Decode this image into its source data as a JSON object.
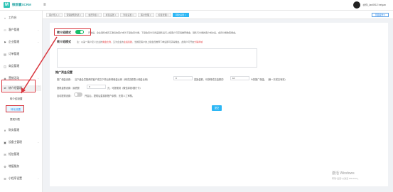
{
  "app": {
    "logo_text": "微群赢SCRM",
    "user_name": "@你_lanl0f12 heiyan"
  },
  "tabs": [
    {
      "label": "客户导入 ×"
    },
    {
      "label": "营销通知列表 ×"
    },
    {
      "label": "会员列表 ×"
    },
    {
      "label": "标签设置 ×"
    },
    {
      "label": "列表设置 ×"
    },
    {
      "label": "客户管理 ×"
    },
    {
      "label": "标签管理 ×"
    },
    {
      "label": "转化设置 ×"
    }
  ],
  "page_action": "页面操作 ▾",
  "sidebar": {
    "items": [
      {
        "label": "工作台",
        "icon": "⌂"
      },
      {
        "label": "客户管理",
        "icon": "⚇"
      },
      {
        "label": "企业管理",
        "icon": "⚑"
      },
      {
        "label": "订单管理",
        "icon": "▤"
      },
      {
        "label": "商品管理",
        "icon": "◫"
      },
      {
        "label": "营销活动",
        "icon": "◈"
      },
      {
        "label": "转介绍管理",
        "icon": "⇄"
      },
      {
        "label": "财务管理",
        "icon": "¥"
      },
      {
        "label": "设备主管理",
        "icon": "▣"
      },
      {
        "label": "短信管理",
        "icon": "✉"
      },
      {
        "label": "增值服务",
        "icon": "⚙"
      },
      {
        "label": "小程序设置",
        "icon": "☰"
      }
    ],
    "sub_items": [
      {
        "label": "转介绍设置"
      },
      {
        "label": "转化设置"
      },
      {
        "label": "提现列表"
      }
    ]
  },
  "form": {
    "referral_label": "转介绍模式",
    "referral_hint": "开启后，企业销售或员工邀请的客户成为下级会员分佣，下级会员分享商品销售后与上级客户可获得推荐佣金，销售与分佣的客户成交后，会员分佣收取佣金。",
    "mode_label": "转介绍模式",
    "mode_hint_prefix": "注：以第一客户定义企业的",
    "mode_hint_red1": "佣金比例",
    "mode_hint_mid": "，又为企业的",
    "mode_hint_red2": "业绩奖励",
    "mode_hint_tail": "，当绑定客户的上级会员推荐下单后即可获得佣金，此用户可开启",
    "mode_hint_red3": "分销商城",
    "section_title": "推广资金设置",
    "commission_label": "推广佣金设置：",
    "commission_desc": "当下级会员推荐的客户成交下单后获得佣金比例（即成交额乘以佣金比例）",
    "commission_value": "0",
    "commission_unit": "%",
    "reward_label": "奖励金额，可获得成交金额的",
    "reward_value": "10",
    "reward_unit": "%的推广佣金。（第一次成交有效）",
    "withdraw_label": "提现金额设置：最低额",
    "withdraw_value": "0",
    "withdraw_unit": "元，可提现到（微信零钱/银行卡）",
    "audit_label": "自动提现设置：",
    "audit_desc": "开启后，提现后直接到账户余额，无需人工审核。",
    "submit_label": "提交"
  },
  "watermark": {
    "title": "激活 Windows",
    "subtitle": "转到\"设置\"以激活 Windows。"
  }
}
